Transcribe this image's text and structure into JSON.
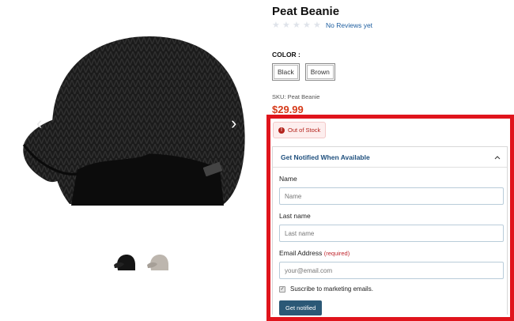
{
  "gallery": {
    "prev_arrow": "‹",
    "next_arrow": "›",
    "thumbnails": [
      {
        "name": "black-beanie-thumb",
        "color": "#151515"
      },
      {
        "name": "brown-beanie-thumb",
        "color": "#bdb6ae"
      }
    ]
  },
  "product": {
    "title": "Peat Beanie",
    "rating_stars": 0,
    "reviews_label": "No Reviews yet",
    "color_label": "COLOR :",
    "color_options": [
      "Black",
      "Brown"
    ],
    "sku_label": "SKU: Peat Beanie",
    "price": "$29.99",
    "price_color": "#d63a1a"
  },
  "notify": {
    "stock_status": "Out of Stock",
    "stock_icon": "!",
    "header_title": "Get Notified When Available",
    "name_label": "Name",
    "name_placeholder": "Name",
    "last_name_label": "Last name",
    "last_name_placeholder": "Last name",
    "email_label": "Email Address",
    "email_required": "(required)",
    "email_placeholder": "your@email.com",
    "marketing_label": "Suscribe to marketing emails.",
    "submit_label": "Get notified",
    "button_color": "#2b5876",
    "highlight_color": "#e0141c"
  }
}
